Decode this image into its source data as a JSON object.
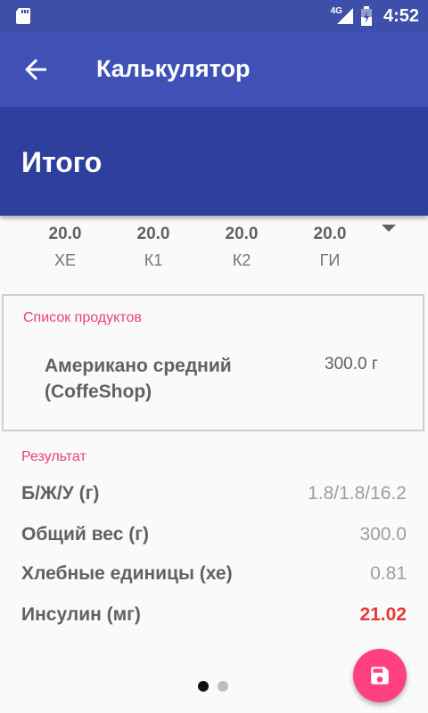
{
  "status_bar": {
    "network": "4G",
    "time": "4:52"
  },
  "toolbar": {
    "title": "Калькулятор"
  },
  "header": {
    "title": "Итого"
  },
  "stats": [
    {
      "value": "20.0",
      "label": "ХЕ"
    },
    {
      "value": "20.0",
      "label": "К1"
    },
    {
      "value": "20.0",
      "label": "К2"
    },
    {
      "value": "20.0",
      "label": "ГИ"
    }
  ],
  "products": {
    "section_label": "Список продуктов",
    "items": [
      {
        "name": "Американо средний (CoffeShop)",
        "weight": "300.0 г"
      }
    ]
  },
  "result": {
    "section_label": "Результат",
    "rows": [
      {
        "key": "Б/Ж/У (г)",
        "value": "1.8/1.8/16.2"
      },
      {
        "key": "Общий вес (г)",
        "value": "300.0"
      },
      {
        "key": "Хлебные единицы (хе)",
        "value": "0.81"
      },
      {
        "key": "Инсулин (мг)",
        "value": "21.02"
      }
    ]
  },
  "colors": {
    "primary": "#3f51b5",
    "primary_dark": "#2f3f9e",
    "accent": "#ff4081",
    "alert": "#e53935"
  },
  "pager": {
    "pages": 2,
    "current": 1
  },
  "icons": {
    "fab": "save-icon",
    "back": "back-arrow-icon"
  }
}
